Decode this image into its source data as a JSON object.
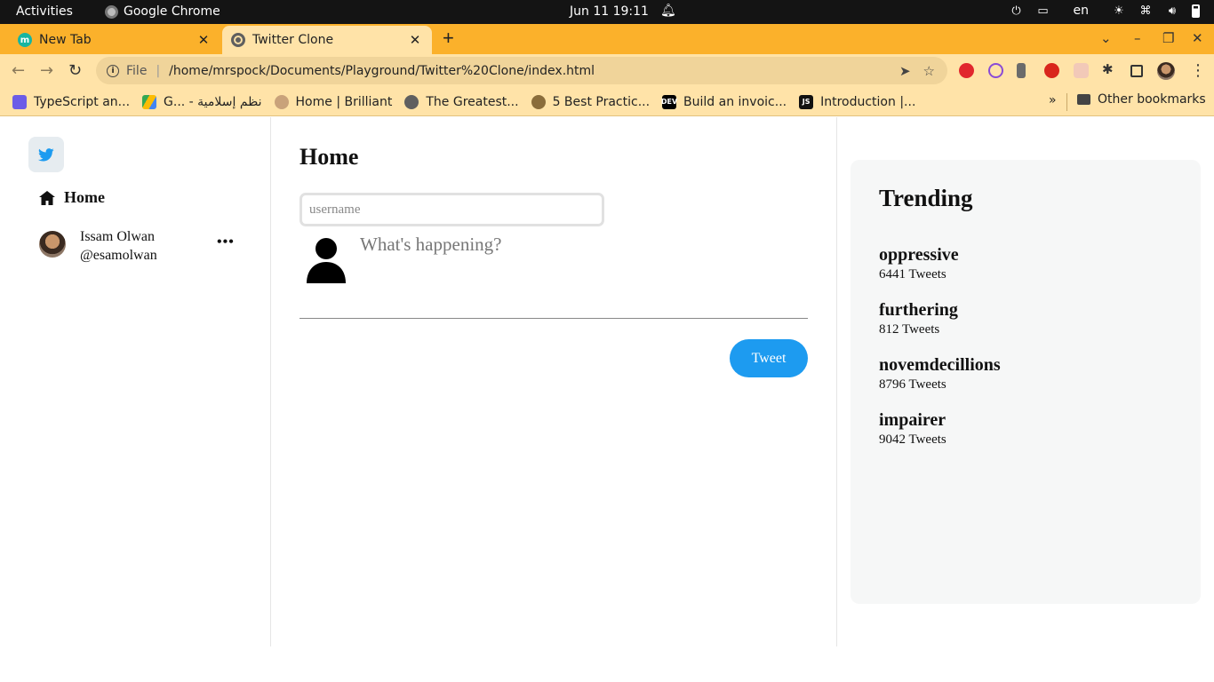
{
  "system_bar": {
    "activities": "Activities",
    "app_name": "Google Chrome",
    "datetime": "Jun 11  19:11",
    "language": "en"
  },
  "tabs": [
    {
      "title": "New Tab",
      "favicon": "m-icon",
      "active": false
    },
    {
      "title": "Twitter Clone",
      "favicon": "globe-icon",
      "active": true
    }
  ],
  "toolbar": {
    "scheme": "File",
    "url": "/home/mrspock/Documents/Playground/Twitter%20Clone/index.html"
  },
  "bookmarks": {
    "items": [
      {
        "label": "TypeScript an...",
        "icon": "typescript-icon"
      },
      {
        "label": "G... - نظم إسلامية",
        "icon": "google-drive-icon"
      },
      {
        "label": "Home | Brilliant",
        "icon": "brilliant-icon"
      },
      {
        "label": "The Greatest...",
        "icon": "globe-icon"
      },
      {
        "label": "5 Best Practic...",
        "icon": "dog-icon"
      },
      {
        "label": "Build an invoic...",
        "icon": "dev-icon"
      },
      {
        "label": "Introduction |...",
        "icon": "nestjs-icon"
      }
    ],
    "more": "»",
    "other": "Other bookmarks"
  },
  "sidebar": {
    "nav_home": "Home",
    "user": {
      "name": "Issam Olwan",
      "handle": "@esamolwan",
      "more": "•••"
    }
  },
  "main": {
    "title": "Home",
    "username_placeholder": "username",
    "compose_placeholder": "What's happening?",
    "tweet_button": "Tweet"
  },
  "trending": {
    "title": "Trending",
    "items": [
      {
        "name": "oppressive",
        "count": "6441 Tweets"
      },
      {
        "name": "furthering",
        "count": "812 Tweets"
      },
      {
        "name": "novemdecillions",
        "count": "8796 Tweets"
      },
      {
        "name": "impairer",
        "count": "9042 Tweets"
      }
    ]
  },
  "colors": {
    "tab_strip": "#fbb12b",
    "toolbar": "#ffe3a8",
    "tweet_button": "#1d9bf0",
    "twitter_blue": "#1d9bf0"
  }
}
